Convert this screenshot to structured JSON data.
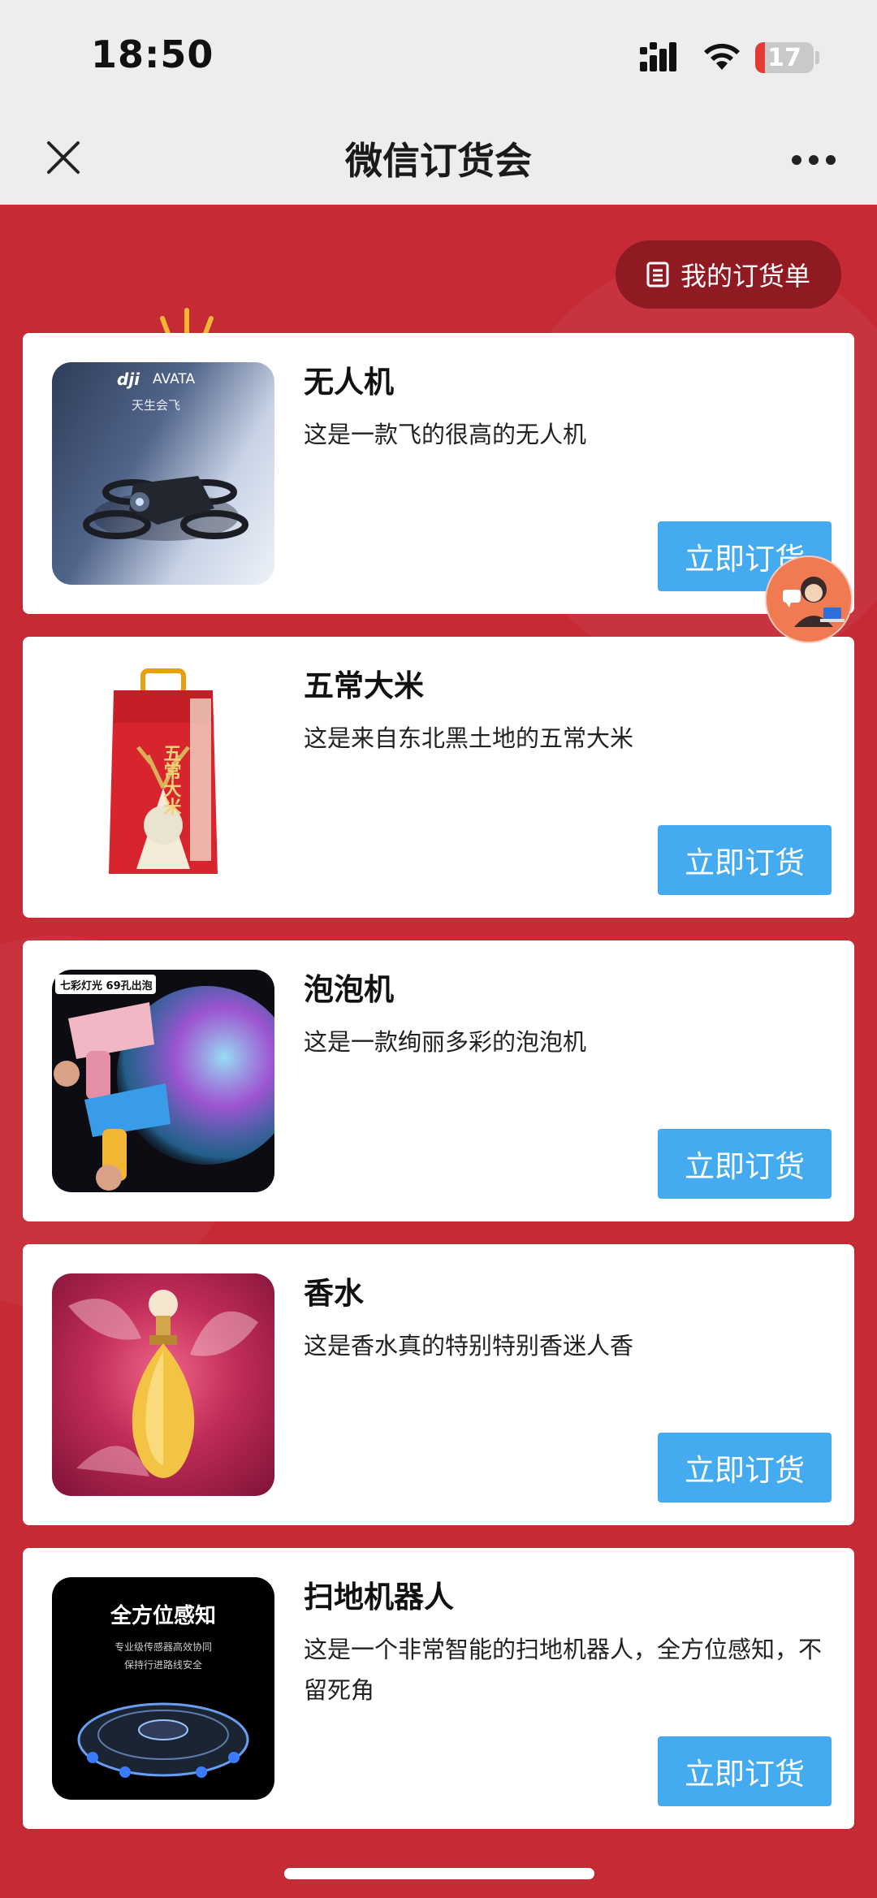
{
  "status_bar": {
    "time": "18:50",
    "battery": "17"
  },
  "nav": {
    "title": "微信订货会",
    "close_icon": "close-icon",
    "more_icon": "more-icon"
  },
  "orders_button": {
    "label": "我的订货单",
    "icon": "list-icon"
  },
  "products": [
    {
      "title": "无人机",
      "description": "这是一款飞的很高的无人机",
      "button": "立即订货",
      "image_text": [
        "AVATA",
        "天生会飞"
      ]
    },
    {
      "title": "五常大米",
      "description": "这是来自东北黑土地的五常大米",
      "button": "立即订货",
      "image_text": [
        "五常大米"
      ]
    },
    {
      "title": "泡泡机",
      "description": "这是一款绚丽多彩的泡泡机",
      "button": "立即订货",
      "image_text": [
        "七彩灯光 69孔出泡"
      ]
    },
    {
      "title": "香水",
      "description": "这是香水真的特别特别香迷人香",
      "button": "立即订货",
      "image_text": []
    },
    {
      "title": "扫地机器人",
      "description": "这是一个非常智能的扫地机器人，全方位感知，不留死角",
      "button": "立即订货",
      "image_text": [
        "全方位感知",
        "专业级传感器高效协同",
        "保持行进路线安全"
      ]
    }
  ],
  "colors": {
    "background": "#c52a35",
    "button": "#44abf0",
    "orders_button": "#8f1a22"
  }
}
